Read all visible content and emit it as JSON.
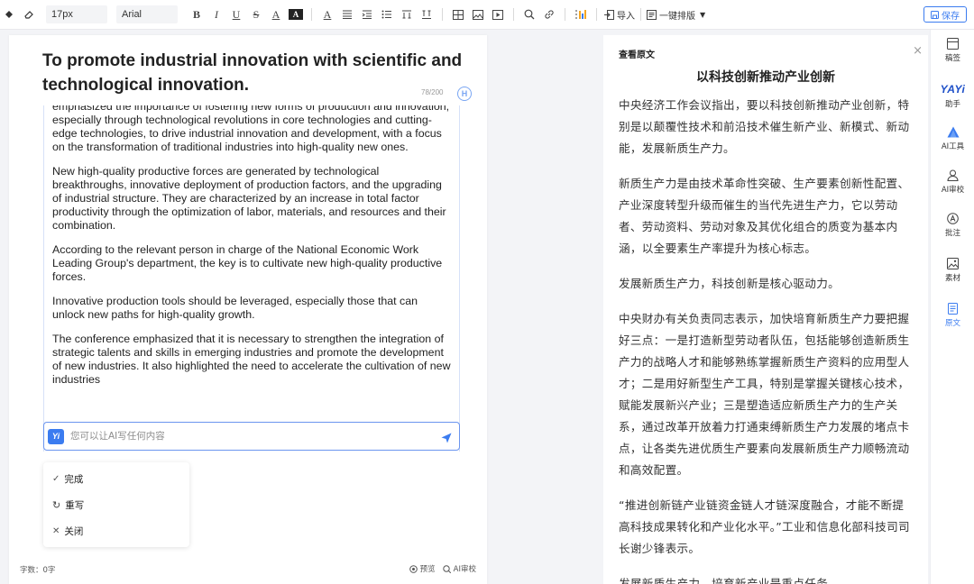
{
  "toolbar": {
    "font_size": "17px",
    "font_family": "Arial",
    "bold": "B",
    "italic": "I",
    "underline": "U",
    "strike": "S",
    "font_color": "A",
    "highlight": "A",
    "clear_format": "A",
    "import_label": "导入",
    "layout_label": "一键排版",
    "save_label": "保存"
  },
  "editor": {
    "title": "To promote industrial innovation with scientific and technological innovation.",
    "counter": "78/200",
    "h_badge": "H",
    "ai_paragraphs": [
      "emphasized the importance of fostering new forms of production and innovation, especially through technological revolutions in core technologies and cutting-edge technologies, to drive industrial innovation and development, with a focus on the transformation of traditional industries into high-quality new ones.",
      "New high-quality productive forces are generated by technological breakthroughs, innovative deployment of production factors, and the upgrading of industrial structure. They are characterized by an increase in total factor productivity through the optimization of labor, materials, and resources and their combination.",
      "According to the relevant person in charge of the National Economic Work Leading Group's department, the key is to cultivate new high-quality productive forces.",
      "Innovative production tools should be leveraged, especially those that can unlock new paths for high-quality growth.",
      "The conference emphasized that it is necessary to strengthen the integration of strategic talents and skills in emerging industries and promote the development of new industries. It also highlighted the need to accelerate the cultivation of new industries"
    ],
    "ai_badge": "Yi",
    "ai_placeholder": "您可以让AI写任何内容",
    "menu": [
      {
        "icon": "check-icon",
        "label": "完成"
      },
      {
        "icon": "refresh-icon",
        "label": "重写"
      },
      {
        "icon": "close-icon",
        "label": "关闭"
      }
    ],
    "word_count": "字数：0字",
    "preview_label": "预览",
    "ai_review_label": "AI审校"
  },
  "source": {
    "label": "查看原文",
    "title": "以科技创新推动产业创新",
    "paragraphs": [
      "中央经济工作会议指出，要以科技创新推动产业创新，特别是以颠覆性技术和前沿技术催生新产业、新模式、新动能，发展新质生产力。",
      "新质生产力是由技术革命性突破、生产要素创新性配置、产业深度转型升级而催生的当代先进生产力，它以劳动者、劳动资料、劳动对象及其优化组合的质变为基本内涵，以全要素生产率提升为核心标志。",
      "发展新质生产力，科技创新是核心驱动力。",
      "中央财办有关负责同志表示，加快培育新质生产力要把握好三点：一是打造新型劳动者队伍，包括能够创造新质生产力的战略人才和能够熟练掌握新质生产资料的应用型人才；二是用好新型生产工具，特别是掌握关键核心技术，赋能发展新兴产业；三是塑造适应新质生产力的生产关系，通过改革开放着力打通束缚新质生产力发展的堵点卡点，让各类先进优质生产要素向发展新质生产力顺畅流动和高效配置。",
      "“推进创新链产业链资金链人才链深度融合，才能不断提高科技成果转化和产业化水平。”工业和信息化部科技司司长谢少锋表示。",
      "发展新质生产力，培育新产业是重点任务。"
    ]
  },
  "sidebar": {
    "items": [
      {
        "icon": "draft-icon",
        "label": "稿签"
      },
      {
        "icon": "yayi-logo",
        "logo_text": "YAYi",
        "label": "助手"
      },
      {
        "icon": "ai-tools-icon",
        "label": "AI工具"
      },
      {
        "icon": "ai-review-icon",
        "label": "AI审校"
      },
      {
        "icon": "annotate-icon",
        "label": "批注"
      },
      {
        "icon": "material-icon",
        "label": "素材"
      },
      {
        "icon": "original-icon",
        "label": "原文"
      }
    ]
  },
  "colors": {
    "accent": "#3b7cf0",
    "active_bg": "#eef3fd"
  }
}
